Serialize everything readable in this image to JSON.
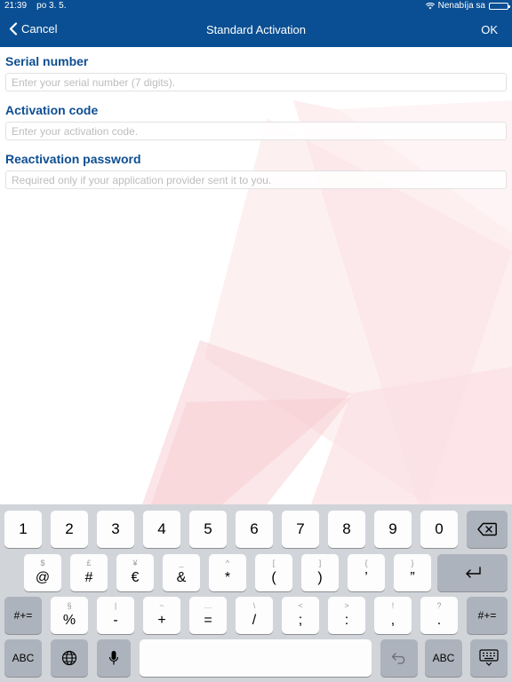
{
  "status": {
    "time": "21:39",
    "date": "po 3. 5.",
    "charging": "Nenabíja sa"
  },
  "nav": {
    "cancel_label": "Cancel",
    "title": "Standard Activation",
    "ok_label": "OK"
  },
  "form": {
    "serial": {
      "label": "Serial number",
      "placeholder": "Enter your serial number (7 digits)."
    },
    "activation": {
      "label": "Activation code",
      "placeholder": "Enter your activation code."
    },
    "reactivation": {
      "label": "Reactivation password",
      "placeholder": "Required only if your application provider sent it to you."
    }
  },
  "keyboard": {
    "row1": [
      "1",
      "2",
      "3",
      "4",
      "5",
      "6",
      "7",
      "8",
      "9",
      "0"
    ],
    "row2": [
      {
        "sub": "$",
        "main": "@"
      },
      {
        "sub": "£",
        "main": "#"
      },
      {
        "sub": "¥",
        "main": "€"
      },
      {
        "sub": "_",
        "main": "&"
      },
      {
        "sub": "^",
        "main": "*"
      },
      {
        "sub": "[",
        "main": "("
      },
      {
        "sub": "]",
        "main": ")"
      },
      {
        "sub": "{",
        "main": "’"
      },
      {
        "sub": "}",
        "main": "”"
      }
    ],
    "row3": [
      {
        "sub": "§",
        "main": "%"
      },
      {
        "sub": "|",
        "main": "-"
      },
      {
        "sub": "~",
        "main": "+"
      },
      {
        "sub": "…",
        "main": "="
      },
      {
        "sub": "\\",
        "main": "/"
      },
      {
        "sub": "<",
        "main": ";"
      },
      {
        "sub": ">",
        "main": ":"
      },
      {
        "sub": "!",
        "main": ","
      },
      {
        "sub": "?",
        "main": "."
      }
    ],
    "shift_label": "#+=",
    "abc_label": "ABC"
  },
  "icons": [
    "chevron-left-icon",
    "wifi-icon",
    "battery-icon",
    "backspace-icon",
    "return-icon",
    "globe-icon",
    "microphone-icon",
    "undo-icon",
    "keyboard-dismiss-icon"
  ],
  "colors": {
    "nav_bg": "#0a4f93",
    "label": "#0e4e92",
    "keyboard_bg": "#d1d4d9"
  }
}
